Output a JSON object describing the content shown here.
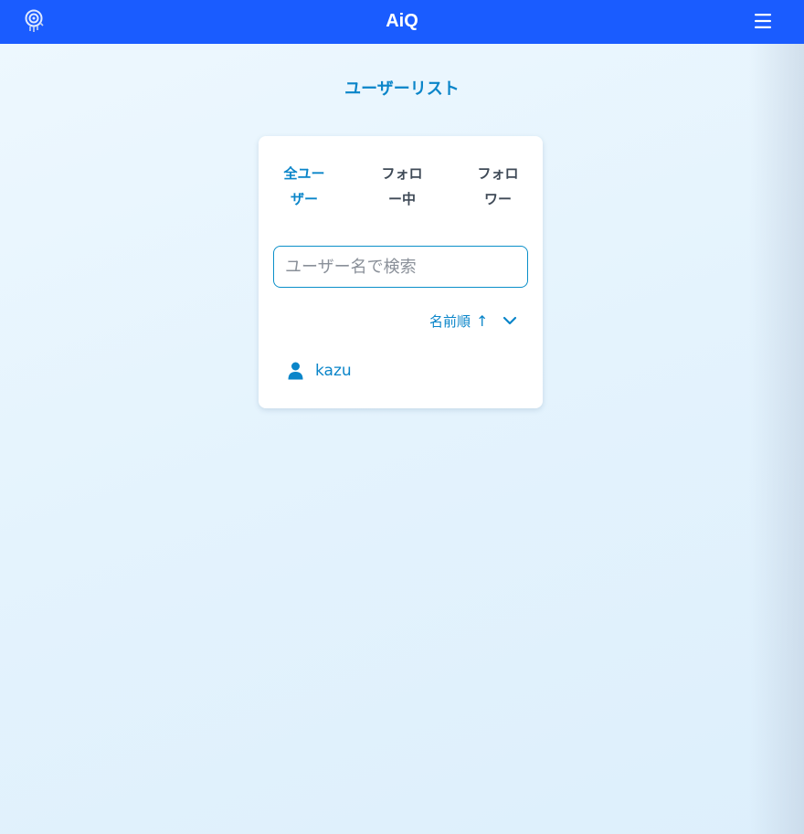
{
  "header": {
    "app_title": "AiQ",
    "logo_icon": "aiq-brain-logo",
    "menu_icon": "hamburger-menu-icon",
    "background_color": "#1a5cff"
  },
  "page": {
    "title": "ユーザーリスト"
  },
  "tabs": [
    {
      "label": "全ユーザー",
      "active": true
    },
    {
      "label": "フォロー中",
      "active": false
    },
    {
      "label": "フォロワー",
      "active": false
    }
  ],
  "search": {
    "value": "",
    "placeholder": "ユーザー名で検索"
  },
  "sort": {
    "label": "名前順",
    "direction_icon": "↑",
    "dropdown_icon": "chevron-down-icon"
  },
  "users": [
    {
      "name": "kazu",
      "icon": "user-icon"
    }
  ],
  "colors": {
    "accent": "#0a85c9",
    "tab_inactive": "#3f4a57",
    "background": "#e6f4fd"
  }
}
